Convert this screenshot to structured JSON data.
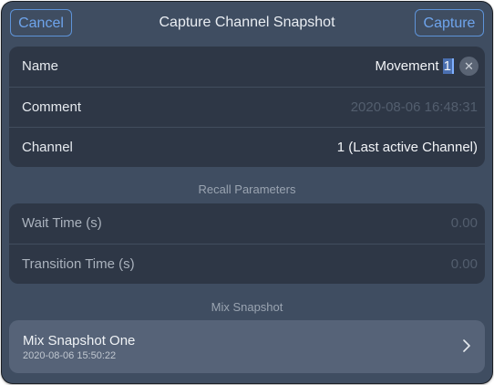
{
  "header": {
    "cancel_label": "Cancel",
    "title": "Capture Channel Snapshot",
    "capture_label": "Capture"
  },
  "form": {
    "name_label": "Name",
    "name_value_prefix": "Movement ",
    "name_value_selected": "1",
    "comment_label": "Comment",
    "comment_placeholder": "2020-08-06 16:48:31",
    "channel_label": "Channel",
    "channel_value": "1 (Last active Channel)"
  },
  "recall": {
    "section_title": "Recall Parameters",
    "wait_label": "Wait Time (s)",
    "wait_placeholder": "0.00",
    "transition_label": "Transition Time (s)",
    "transition_placeholder": "0.00"
  },
  "mix": {
    "section_title": "Mix Snapshot",
    "item_title": "Mix Snapshot One",
    "item_date": "2020-08-06 15:50:22"
  },
  "icons": {
    "clear": "close-icon",
    "chevron": "chevron-right-icon"
  },
  "colors": {
    "accent": "#6ea4ec",
    "background": "#3f4d61",
    "group": "#2e3746",
    "card": "#566378"
  }
}
